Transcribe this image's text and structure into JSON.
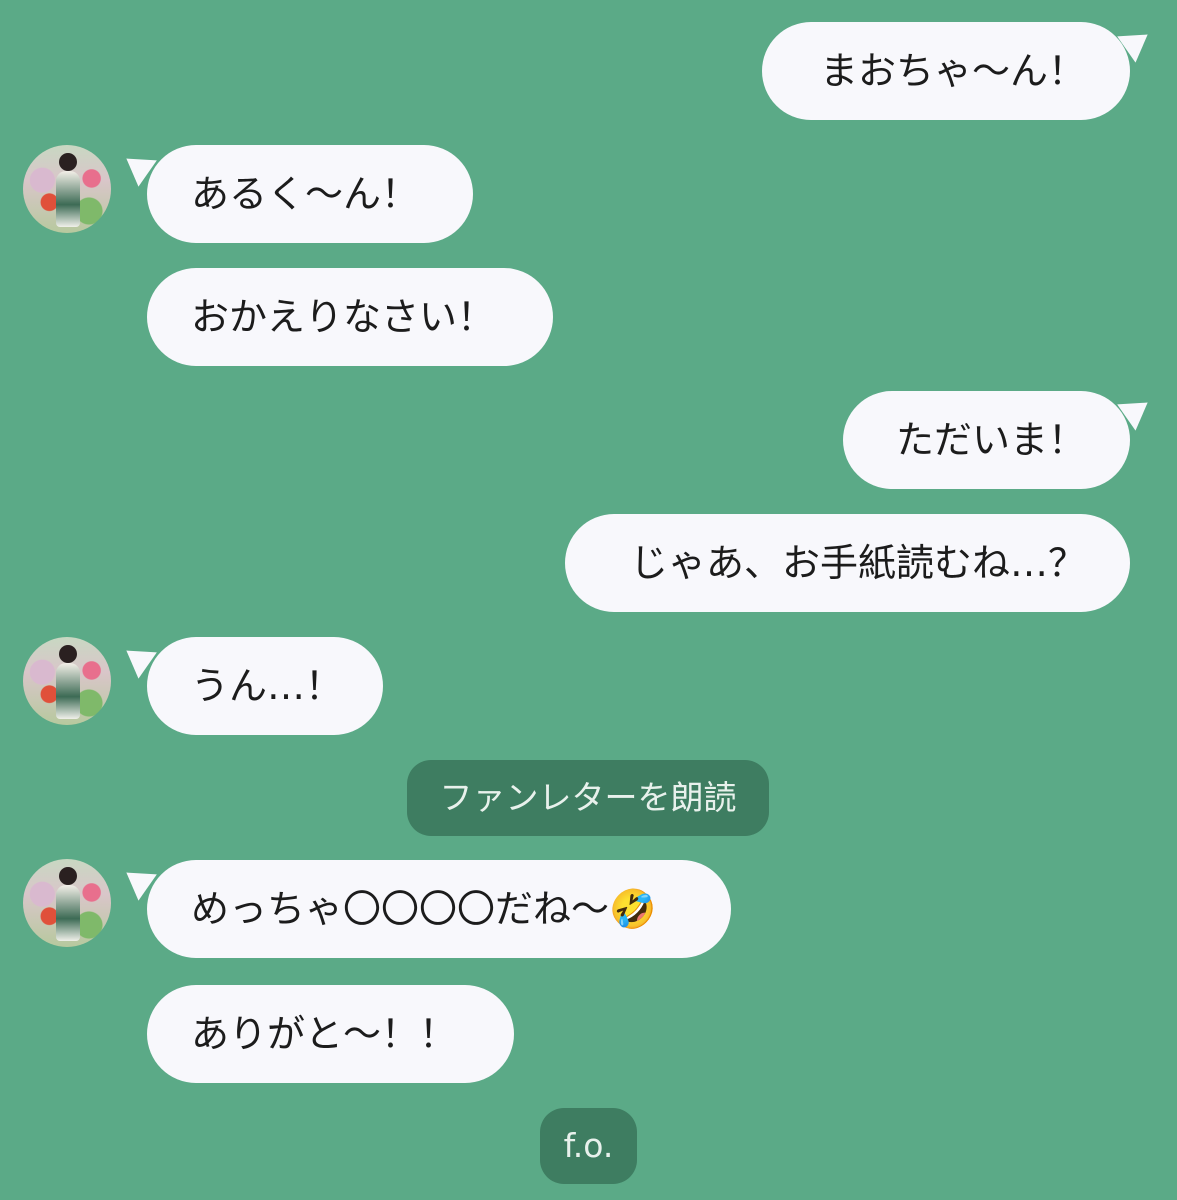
{
  "messages": [
    {
      "side": "right",
      "text": "まおちゃ〜ん！"
    },
    {
      "side": "left",
      "text": "あるく〜ん！",
      "avatar": "avatar-photo"
    },
    {
      "side": "left",
      "text": "おかえりなさい！"
    },
    {
      "side": "right",
      "text": "ただいま！"
    },
    {
      "side": "right",
      "text": "じゃあ、お手紙読むね…？"
    },
    {
      "side": "left",
      "text": "うん…！",
      "avatar": "avatar-photo"
    },
    {
      "side": "system",
      "text": "ファンレターを朗読"
    },
    {
      "side": "left",
      "text": "めっちゃ〇〇〇〇だね〜🤣",
      "avatar": "avatar-photo"
    },
    {
      "side": "left",
      "text": "ありがと〜！！"
    },
    {
      "side": "system",
      "text": "f.o."
    }
  ],
  "colors": {
    "background": "#5baa87",
    "bubble": "#f8f8fc",
    "system_badge": "#3e7d61",
    "text": "#1c1c1c"
  }
}
